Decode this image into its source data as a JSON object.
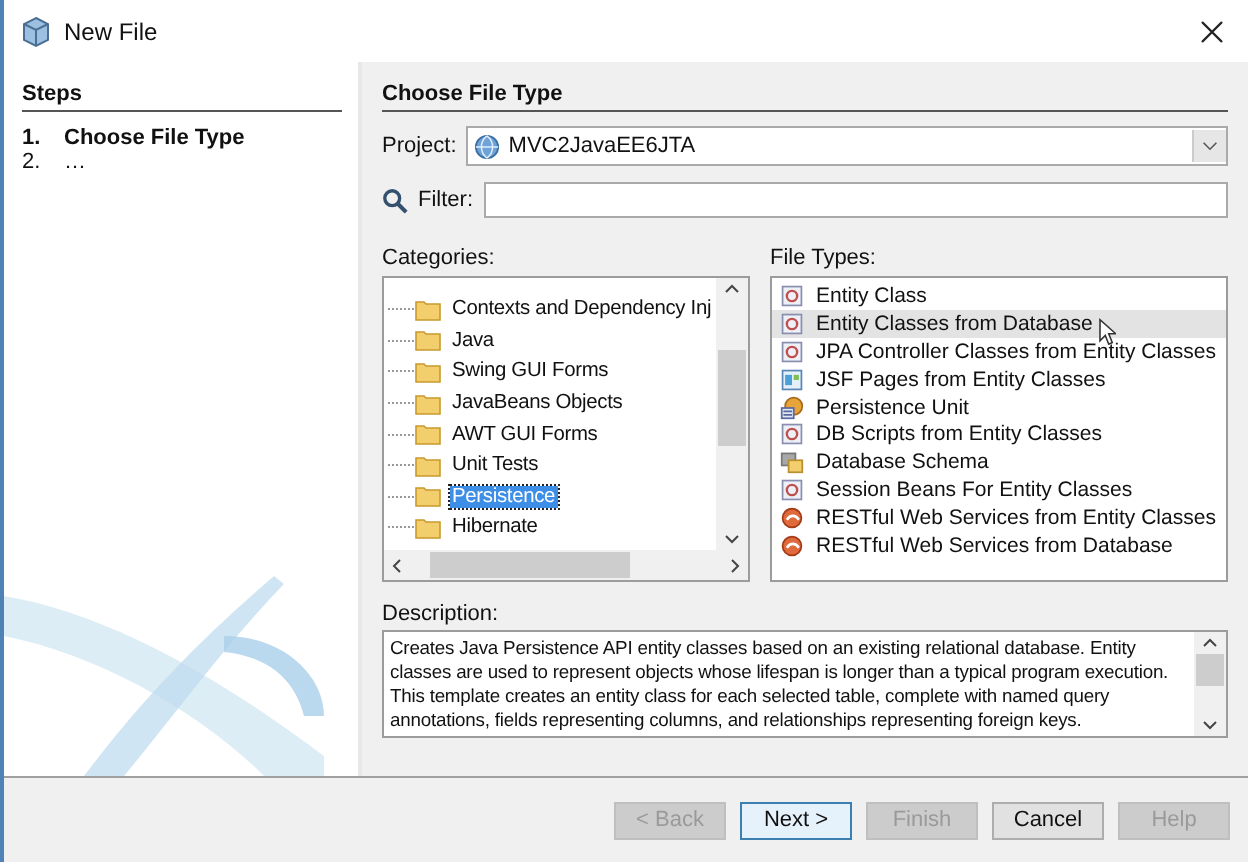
{
  "window": {
    "title": "New File"
  },
  "steps": {
    "title": "Steps",
    "items": [
      {
        "number": "1.",
        "label": "Choose File Type",
        "selected": true
      },
      {
        "number": "2.",
        "label": "…",
        "selected": false
      }
    ]
  },
  "panel": {
    "title": "Choose File Type"
  },
  "project": {
    "label": "Project:",
    "value": "MVC2JavaEE6JTA"
  },
  "filter": {
    "label": "Filter:"
  },
  "categories": {
    "label": "Categories:",
    "items": [
      {
        "label": "Contexts and Dependency Inj",
        "selected": false
      },
      {
        "label": "Java",
        "selected": false
      },
      {
        "label": "Swing GUI Forms",
        "selected": false
      },
      {
        "label": "JavaBeans Objects",
        "selected": false
      },
      {
        "label": "AWT GUI Forms",
        "selected": false
      },
      {
        "label": "Unit Tests",
        "selected": false
      },
      {
        "label": "Persistence",
        "selected": true
      },
      {
        "label": "Hibernate",
        "selected": false
      }
    ]
  },
  "file_types": {
    "label": "File Types:",
    "items": [
      {
        "label": "Entity Class",
        "kind": "entity",
        "selected": false
      },
      {
        "label": "Entity Classes from Database",
        "kind": "entity",
        "selected": true
      },
      {
        "label": "JPA Controller Classes from Entity Classes",
        "kind": "entity",
        "selected": false
      },
      {
        "label": "JSF Pages from Entity Classes",
        "kind": "jsf",
        "selected": false
      },
      {
        "label": "Persistence Unit",
        "kind": "persistence",
        "selected": false
      },
      {
        "label": "DB Scripts from Entity Classes",
        "kind": "entity",
        "selected": false
      },
      {
        "label": "Database Schema",
        "kind": "schema",
        "selected": false
      },
      {
        "label": "Session Beans For Entity Classes",
        "kind": "entity",
        "selected": false
      },
      {
        "label": "RESTful Web Services from Entity Classes",
        "kind": "rest",
        "selected": false
      },
      {
        "label": "RESTful Web Services from Database",
        "kind": "rest",
        "selected": false
      }
    ]
  },
  "description": {
    "label": "Description:",
    "text": "Creates Java Persistence API entity classes based on an existing relational database. Entity classes are used to represent objects whose lifespan is longer than a typical program execution. This template creates an entity class for each selected table, complete with named query annotations, fields representing columns, and relationships representing foreign keys."
  },
  "buttons": [
    {
      "label": "< Back",
      "disabled": true,
      "default": false
    },
    {
      "label": "Next >",
      "disabled": false,
      "default": true
    },
    {
      "label": "Finish",
      "disabled": true,
      "default": false
    },
    {
      "label": "Cancel",
      "disabled": false,
      "default": false
    },
    {
      "label": "Help",
      "disabled": true,
      "default": false
    }
  ]
}
